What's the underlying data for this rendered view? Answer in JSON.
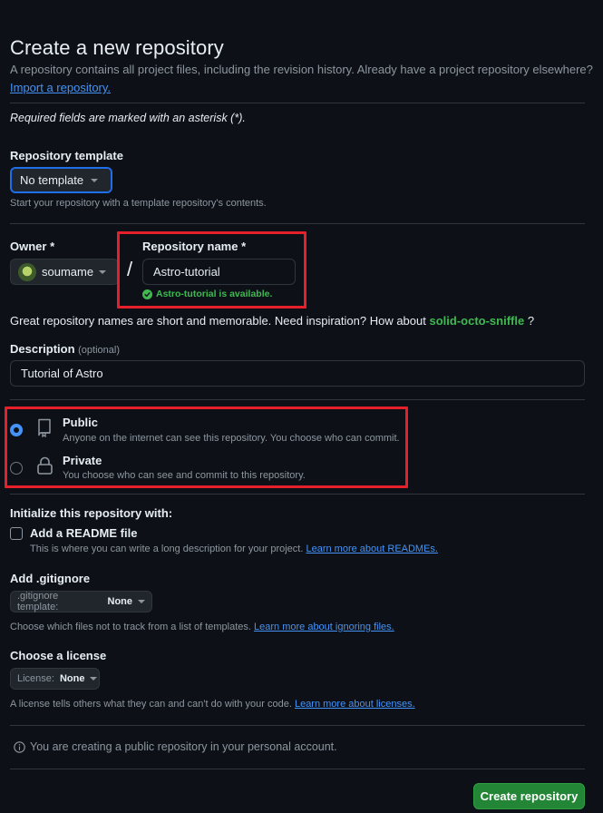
{
  "header": {
    "title": "Create a new repository",
    "intro": "A repository contains all project files, including the revision history. Already have a project repository elsewhere?",
    "import_link": "Import a repository.",
    "required_note": "Required fields are marked with an asterisk (*)."
  },
  "template": {
    "label": "Repository template",
    "value": "No template",
    "help": "Start your repository with a template repository's contents."
  },
  "owner": {
    "label": "Owner *",
    "value": "soumame",
    "separator": "/"
  },
  "repo_name": {
    "label": "Repository name *",
    "value": "Astro-tutorial",
    "availability": "Astro-tutorial is available."
  },
  "suggestion": {
    "text": "Great repository names are short and memorable. Need inspiration? How about",
    "name": "solid-octo-sniffle",
    "suffix": "?"
  },
  "description": {
    "label": "Description",
    "optional": "(optional)",
    "value": "Tutorial of Astro"
  },
  "visibility": {
    "public": {
      "title": "Public",
      "desc": "Anyone on the internet can see this repository. You choose who can commit.",
      "checked": true
    },
    "private": {
      "title": "Private",
      "desc": "You choose who can see and commit to this repository.",
      "checked": false
    }
  },
  "init": {
    "heading": "Initialize this repository with:",
    "readme_label": "Add a README file",
    "readme_help": "This is where you can write a long description for your project.",
    "readme_link": "Learn more about READMEs."
  },
  "gitignore": {
    "label": "Add .gitignore",
    "select_prefix": ".gitignore template:",
    "select_value": "None",
    "help": "Choose which files not to track from a list of templates.",
    "help_link": "Learn more about ignoring files."
  },
  "license": {
    "label": "Choose a license",
    "select_prefix": "License:",
    "select_value": "None",
    "help": "A license tells others what they can and can't do with your code.",
    "help_link": "Learn more about licenses."
  },
  "notice": "You are creating a public repository in your personal account.",
  "submit": "Create repository",
  "colors": {
    "accent": "#4493f8",
    "success": "#3fb950",
    "primary_button": "#238636",
    "highlight_box": "#e5202a",
    "background": "#0d1117"
  }
}
